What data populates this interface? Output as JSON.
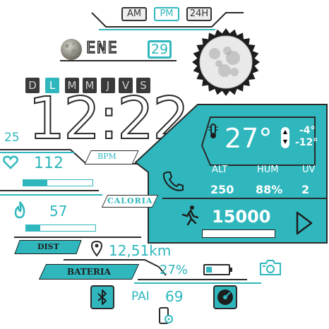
{
  "time_format": {
    "am": "AM",
    "pm": "PM",
    "h24": "24H"
  },
  "date": {
    "month": "ENE",
    "day": "29"
  },
  "weekdays": [
    "D",
    "L",
    "M",
    "M",
    "J",
    "V",
    "S"
  ],
  "clock": {
    "time": "12:22",
    "seconds": "25"
  },
  "heart": {
    "value": "112",
    "unit": "BPM",
    "progress": 0.35
  },
  "calories": {
    "label": "CALORIA",
    "value": "57",
    "progress": 0.2
  },
  "distance": {
    "label": "DIST",
    "value": "12,51km"
  },
  "battery": {
    "label": "BATERIA",
    "value": "27%",
    "level": 0.27
  },
  "pai": {
    "label": "PAI",
    "value": "69"
  },
  "weather": {
    "temp": "27°",
    "high": "-4°",
    "low": "-12°",
    "alt_label": "ALT",
    "hum_label": "HUM",
    "uv_label": "UV",
    "alt": "250",
    "hum": "88%",
    "uv": "2"
  },
  "steps": {
    "value": "15000",
    "progress": 0
  },
  "colors": {
    "accent": "#2fb7bd",
    "dark": "#2a2a2a"
  },
  "icons": [
    "moon-icon",
    "thermometer-icon",
    "phone-icon",
    "runner-icon",
    "play-icon",
    "heart-icon",
    "flame-icon",
    "location-icon",
    "camera-icon",
    "bluetooth-icon",
    "music-icon",
    "phone-settings-icon"
  ]
}
